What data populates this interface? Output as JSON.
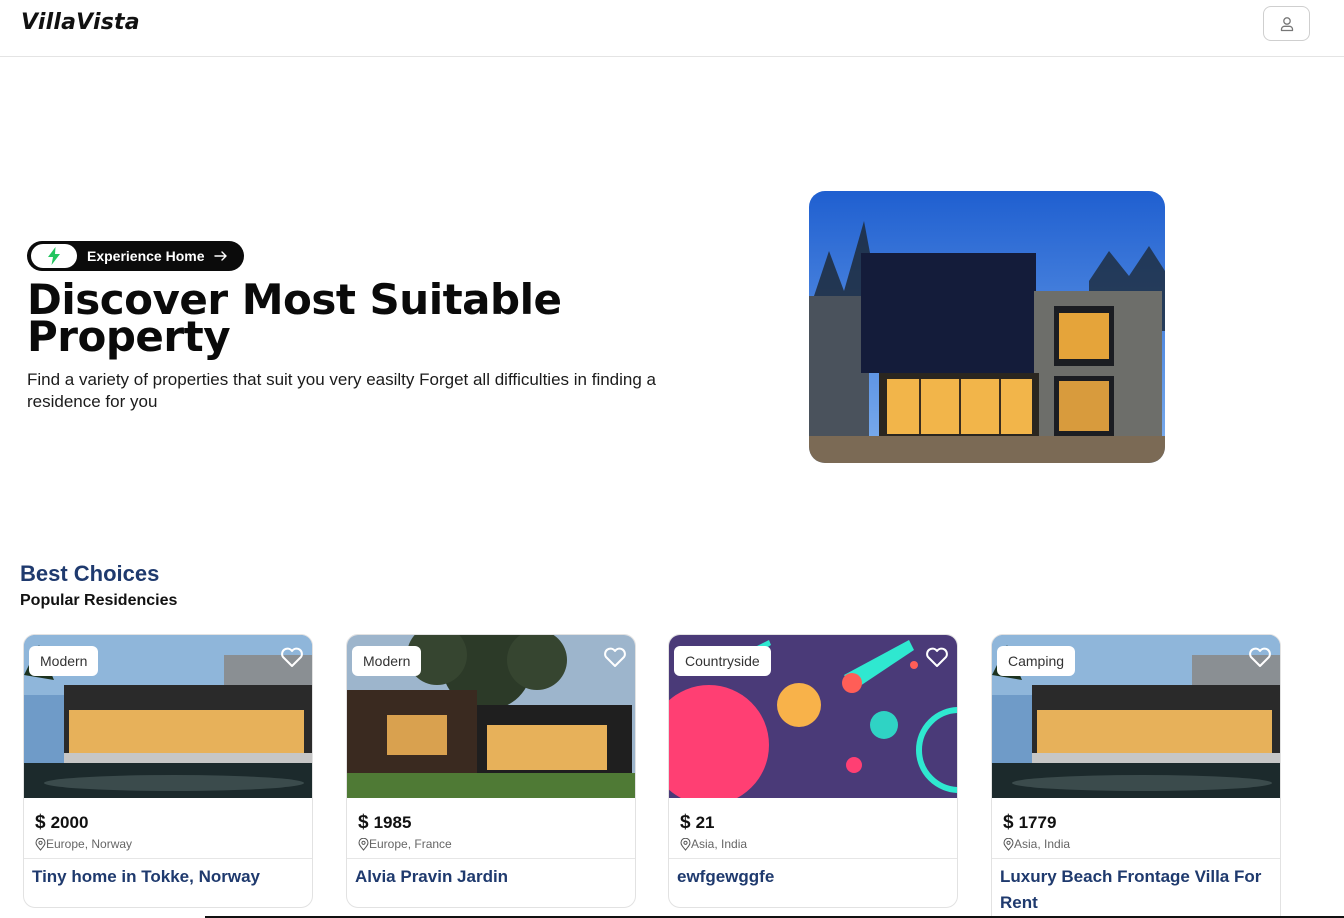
{
  "app": {
    "logo": "VillaVista"
  },
  "header": {
    "user_button_icon": "user-icon"
  },
  "hero": {
    "pill_label": "Experience Home",
    "pill_icon": "lightning-icon",
    "title_line1": "Discover Most Suitable",
    "title_line2": "Property",
    "description": "Find a variety of properties that suit you very easilty Forget all difficulties in finding a residence for you"
  },
  "section": {
    "title": "Best Choices",
    "subtitle": "Popular Residencies"
  },
  "cards": [
    {
      "tag": "Modern",
      "currency": "$",
      "price": "2000",
      "location": "Europe, Norway",
      "name": "Tiny home in Tokke, Norway"
    },
    {
      "tag": "Modern",
      "currency": "$",
      "price": "1985",
      "location": "Europe, France",
      "name": "Alvia Pravin Jardin"
    },
    {
      "tag": "Countryside",
      "currency": "$",
      "price": "21",
      "location": "Asia, India",
      "name": "ewfgewggfe"
    },
    {
      "tag": "Camping",
      "currency": "$",
      "price": "1779",
      "location": "Asia, India",
      "name": "Luxury Beach Frontage Villa For Rent"
    }
  ],
  "colors": {
    "accent": "#1f3a6e",
    "lightning": "#22c55e",
    "pill_bg": "#0b0b0b"
  }
}
